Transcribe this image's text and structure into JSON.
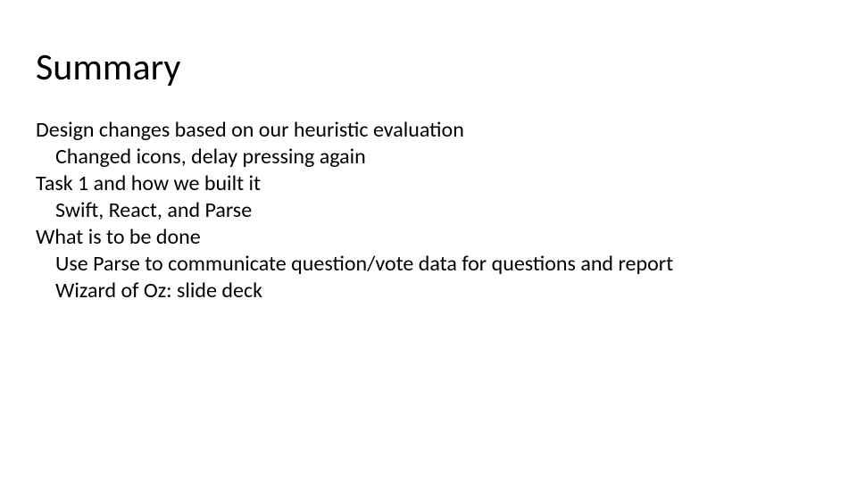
{
  "slide": {
    "title": "Summary",
    "items": [
      {
        "text": "Design changes based on our heuristic evaluation",
        "level": 0
      },
      {
        "text": "Changed icons, delay pressing again",
        "level": 1
      },
      {
        "text": "Task 1 and how we built it",
        "level": 0
      },
      {
        "text": "Swift, React, and Parse",
        "level": 1
      },
      {
        "text": "What is to be done",
        "level": 0
      },
      {
        "text": "Use Parse to communicate question/vote data for questions and report",
        "level": 1
      },
      {
        "text": "Wizard of Oz: slide deck",
        "level": 1
      }
    ]
  }
}
